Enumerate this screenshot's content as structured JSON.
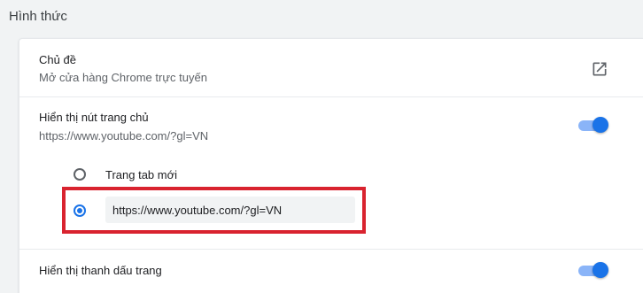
{
  "section_title": "Hình thức",
  "theme": {
    "label": "Chủ đề",
    "sublabel": "Mở cửa hàng Chrome trực tuyến",
    "icon": "open-in-new-icon"
  },
  "home_button": {
    "label": "Hiển thị nút trang chủ",
    "sublabel": "https://www.youtube.com/?gl=VN",
    "enabled": true,
    "options": [
      {
        "label": "Trang tab mới",
        "selected": false
      },
      {
        "value": "https://www.youtube.com/?gl=VN",
        "selected": true
      }
    ]
  },
  "bookmarks_bar": {
    "label": "Hiển thị thanh dấu trang",
    "enabled": true
  },
  "colors": {
    "accent": "#1a73e8",
    "toggle_track": "#8ab4f8",
    "highlight": "#d9232f"
  }
}
